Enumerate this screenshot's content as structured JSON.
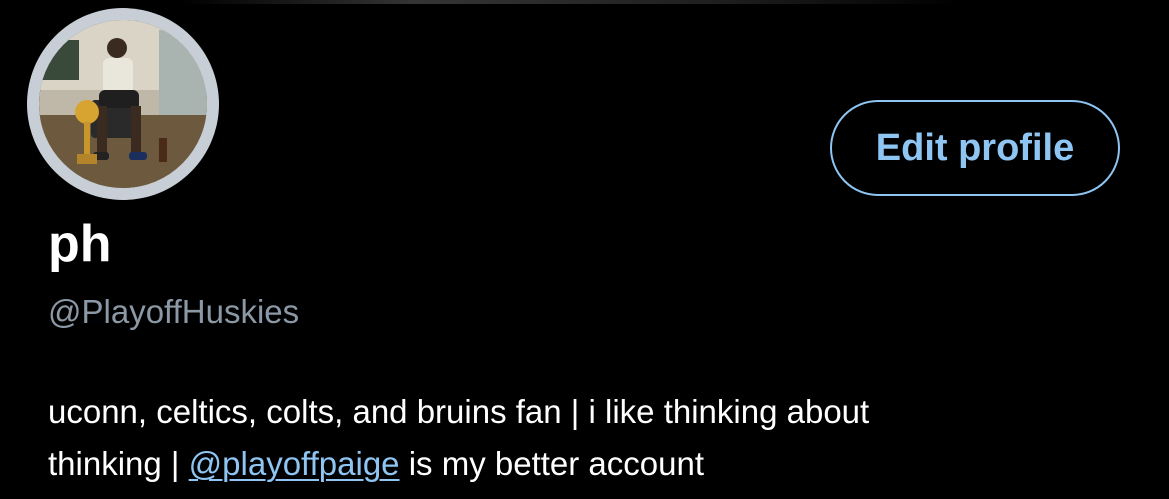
{
  "profile": {
    "display_name": "ph",
    "handle": "@PlayoffHuskies",
    "edit_button_label": "Edit profile",
    "bio": {
      "line1": "uconn, celtics, colts, and bruins fan | i like thinking about",
      "line2_prefix": "thinking | ",
      "mention": "@playoffpaige",
      "line2_suffix": " is my better account"
    }
  },
  "colors": {
    "background": "#000000",
    "accent": "#8ec5f2",
    "secondary_text": "#8b98a5",
    "avatar_ring": "#c7ced6"
  },
  "icons": {
    "avatar": "profile-photo"
  }
}
